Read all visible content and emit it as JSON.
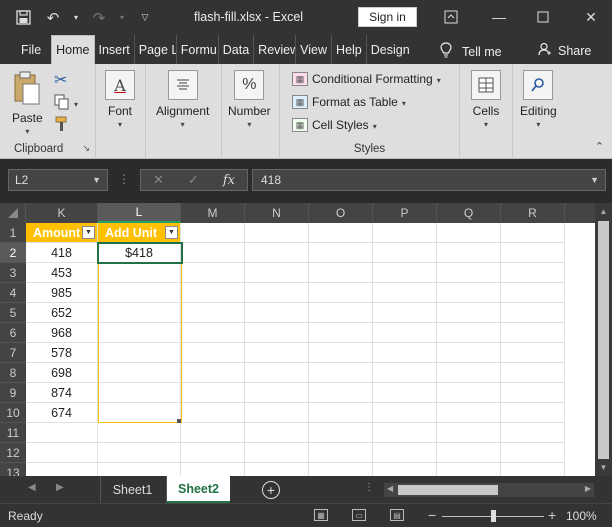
{
  "app": {
    "file_title": "flash-fill.xlsx  -  Excel",
    "signin_label": "Sign in"
  },
  "menu": {
    "tabs": [
      "File",
      "Home",
      "Insert",
      "Page L",
      "Formu",
      "Data",
      "Review",
      "View",
      "Help",
      "Design"
    ],
    "active_tab": "Home",
    "tellme_label": "Tell me",
    "share_label": "Share"
  },
  "ribbon": {
    "clipboard": {
      "paste_label": "Paste",
      "group_label": "Clipboard"
    },
    "font": {
      "label": "Font",
      "icon_letter": "A"
    },
    "alignment": {
      "label": "Alignment"
    },
    "number": {
      "label": "Number",
      "icon_symbol": "%"
    },
    "styles": {
      "conditional_formatting": "Conditional Formatting",
      "format_as_table": "Format as Table",
      "cell_styles": "Cell Styles",
      "group_label": "Styles"
    },
    "cells": {
      "label": "Cells"
    },
    "editing": {
      "label": "Editing"
    }
  },
  "formula_bar": {
    "name_box": "L2",
    "fx_label": "fx",
    "value": "418"
  },
  "grid": {
    "columns": [
      "K",
      "L",
      "M",
      "N",
      "O",
      "P",
      "Q",
      "R"
    ],
    "selected_column": "L",
    "rows": [
      "1",
      "2",
      "3",
      "4",
      "5",
      "6",
      "7",
      "8",
      "9",
      "10",
      "11",
      "12",
      "13"
    ],
    "selected_row": "2",
    "header_k": "Amount",
    "header_l": "Add Unit",
    "amounts": [
      "418",
      "453",
      "985",
      "652",
      "968",
      "578",
      "698",
      "874",
      "674"
    ],
    "l2_value": "$418"
  },
  "sheets": {
    "tabs": [
      "Sheet1",
      "Sheet2"
    ],
    "active": "Sheet2"
  },
  "status": {
    "text": "Ready",
    "zoom": "100%",
    "zoom_level": 1.0
  },
  "colors": {
    "accent": "#217346",
    "table_header": "#ffc000"
  }
}
